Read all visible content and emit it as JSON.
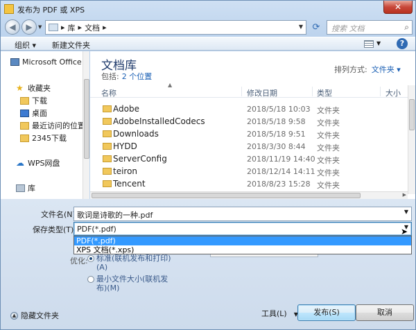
{
  "window": {
    "title": "发布为 PDF 或 XPS",
    "close_label": "✕"
  },
  "address": {
    "path": [
      "库",
      "文档"
    ],
    "search_placeholder": "搜索 文档"
  },
  "toolbar": {
    "organize": "组织 ▾",
    "new_folder": "新建文件夹",
    "help": "?"
  },
  "sidebar": {
    "items": [
      {
        "label": "Microsoft Office V",
        "icon": "computer-icon"
      },
      {
        "label": "收藏夹",
        "icon": "star-icon"
      },
      {
        "label": "下载",
        "icon": "folder-icon"
      },
      {
        "label": "桌面",
        "icon": "desktop-icon"
      },
      {
        "label": "最近访问的位置",
        "icon": "recent-folder-icon"
      },
      {
        "label": "2345下载",
        "icon": "folder-icon"
      },
      {
        "label": "WPS网盘",
        "icon": "cloud-icon"
      },
      {
        "label": "库",
        "icon": "library-icon"
      }
    ]
  },
  "library": {
    "title": "文档库",
    "includes_label": "包括:",
    "includes_link": "2 个位置",
    "arrange_label": "排列方式:",
    "arrange_value": "文件夹 ▾"
  },
  "columns": {
    "name": "名称",
    "date": "修改日期",
    "type": "类型",
    "size": "大小"
  },
  "files": [
    {
      "name": "Adobe",
      "date": "2018/5/18 10:03",
      "type": "文件夹"
    },
    {
      "name": "AdobeInstalledCodecs",
      "date": "2018/5/18 9:58",
      "type": "文件夹"
    },
    {
      "name": "Downloads",
      "date": "2018/5/18 9:51",
      "type": "文件夹"
    },
    {
      "name": "HYDD",
      "date": "2018/3/30 8:44",
      "type": "文件夹"
    },
    {
      "name": "ServerConfig",
      "date": "2018/11/19 14:40",
      "type": "文件夹"
    },
    {
      "name": "teiron",
      "date": "2018/12/14 14:11",
      "type": "文件夹"
    },
    {
      "name": "Tencent",
      "date": "2018/8/23 15:28",
      "type": "文件夹"
    }
  ],
  "form": {
    "filename_label": "文件名(N):",
    "filename_value": "歌词是诗歌的一种.pdf",
    "filetype_label": "保存类型(T):",
    "filetype_value": "PDF(*.pdf)",
    "filetype_options": [
      "PDF(*.pdf)",
      "XPS 文档(*.xps)"
    ],
    "optimize_label": "优化:",
    "radio1_line1": "标准(联机发布和打印)",
    "radio1_line2": "(A)",
    "radio2_line1": "最小文件大小(联机发",
    "radio2_line2": "布)(M)"
  },
  "footer": {
    "hide_folders": "隐藏文件夹",
    "tools": "工具(L)",
    "publish": "发布(S)",
    "cancel": "取消"
  }
}
